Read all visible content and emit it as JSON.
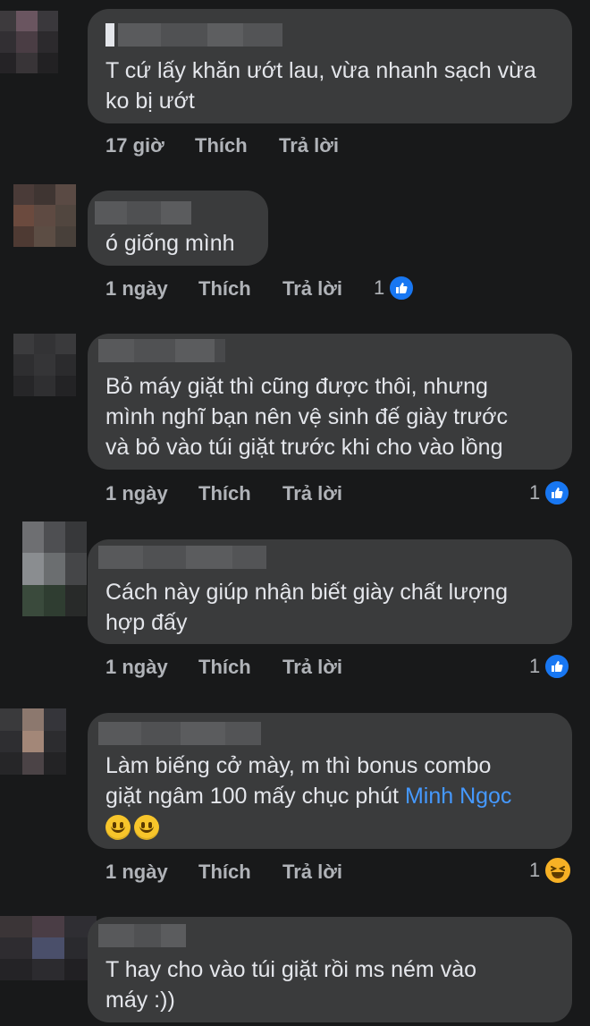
{
  "theme": {
    "background": "#18191a",
    "bubble": "#3a3b3c",
    "text": "#e4e6eb",
    "muted": "#b0b3b8",
    "mention": "#4599ff",
    "like_blue": "#1877f2",
    "haha_yellow": "#f7b125"
  },
  "comments": [
    {
      "text": "T cứ lấy khăn ướt lau, vừa nhanh sạch vừa\nko bị ướt",
      "time": "17 giờ",
      "like_label": "Thích",
      "reply_label": "Trả lời",
      "reaction_count": "",
      "reaction_icon": ""
    },
    {
      "text": "ó giống mình",
      "time": "1 ngày",
      "like_label": "Thích",
      "reply_label": "Trả lời",
      "reaction_count": "1",
      "reaction_icon": "like-icon"
    },
    {
      "text": "Bỏ máy giặt thì cũng được thôi, nhưng\nmình nghĩ bạn nên vệ sinh đế giày trước\nvà bỏ vào túi giặt trước khi cho vào lồng",
      "time": "1 ngày",
      "like_label": "Thích",
      "reply_label": "Trả lời",
      "reaction_count": "1",
      "reaction_icon": "like-icon"
    },
    {
      "text": "Cách này giúp nhận biết giày chất lượng\nhợp đấy",
      "time": "1 ngày",
      "like_label": "Thích",
      "reply_label": "Trả lời",
      "reaction_count": "1",
      "reaction_icon": "like-icon"
    },
    {
      "text_before": "Làm biếng cở mày, m thì bonus combo\ngiặt ngâm 100 mấy chục phút ",
      "mention": "Minh Ngọc",
      "emojis": [
        "smile-emoji",
        "smile-emoji"
      ],
      "time": "1 ngày",
      "like_label": "Thích",
      "reply_label": "Trả lời",
      "reaction_count": "1",
      "reaction_icon": "haha-icon"
    },
    {
      "text": "T hay cho vào túi giặt rồi ms ném vào\nmáy :))"
    }
  ]
}
